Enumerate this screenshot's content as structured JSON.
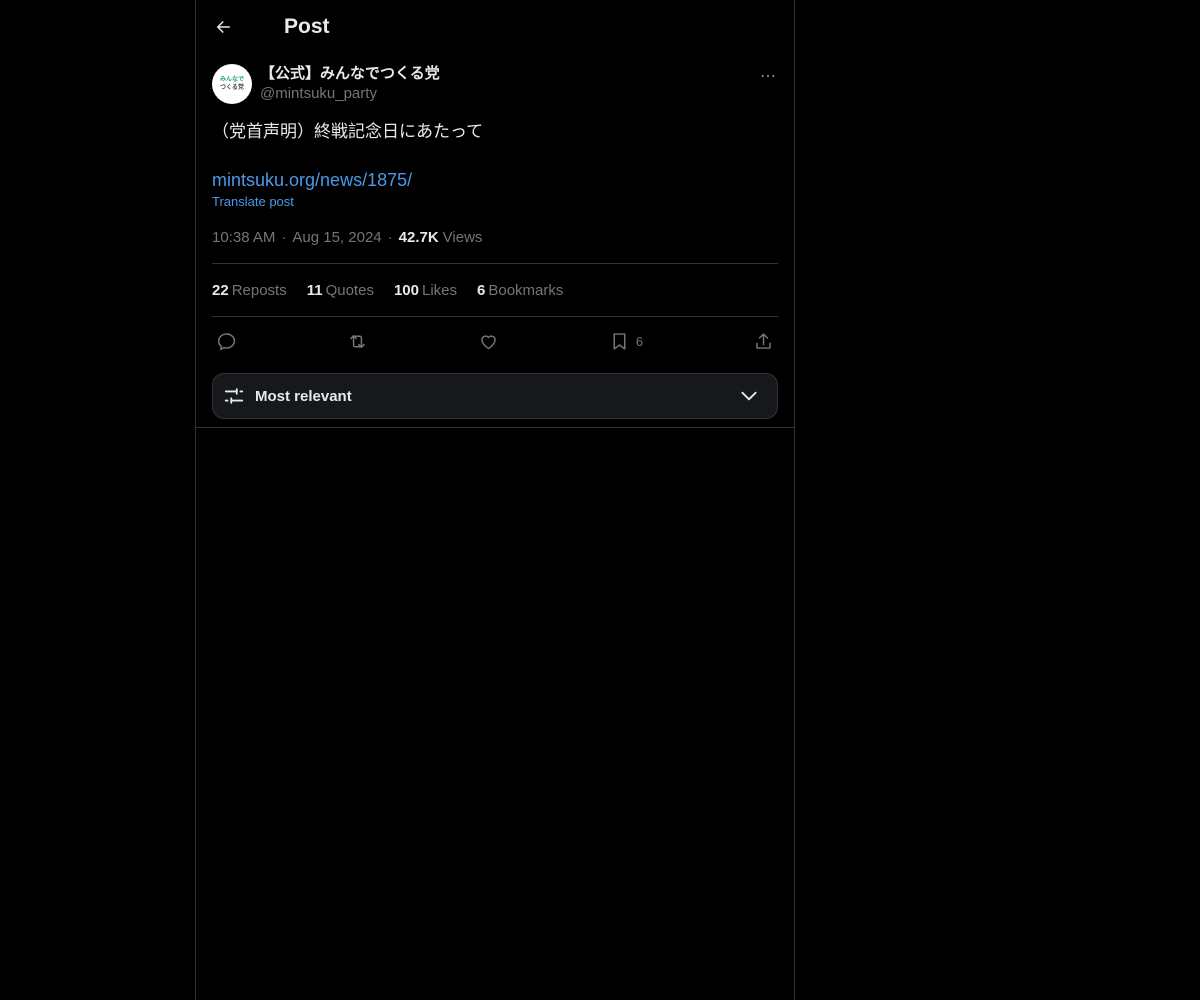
{
  "header": {
    "title": "Post"
  },
  "author": {
    "display_name": "【公式】みんなでつくる党",
    "handle": "@mintsuku_party",
    "avatar_line1": "みんなで",
    "avatar_line2": "つくる党"
  },
  "post": {
    "text": "（党首声明）終戦記念日にあたって",
    "link": "mintsuku.org/news/1875/",
    "translate_label": "Translate post",
    "time": "10:38 AM",
    "date": "Aug 15, 2024",
    "views_count": "42.7K",
    "views_label": "Views"
  },
  "stats": {
    "reposts_count": "22",
    "reposts_label": "Reposts",
    "quotes_count": "11",
    "quotes_label": "Quotes",
    "likes_count": "100",
    "likes_label": "Likes",
    "bookmarks_count": "6",
    "bookmarks_label": "Bookmarks"
  },
  "actions": {
    "bookmark_count": "6"
  },
  "sort": {
    "label": "Most relevant"
  },
  "icons": [
    "back-arrow-icon",
    "more-icon",
    "reply-icon",
    "repost-icon",
    "like-icon",
    "bookmark-icon",
    "share-icon",
    "sliders-icon",
    "chevron-down-icon"
  ]
}
